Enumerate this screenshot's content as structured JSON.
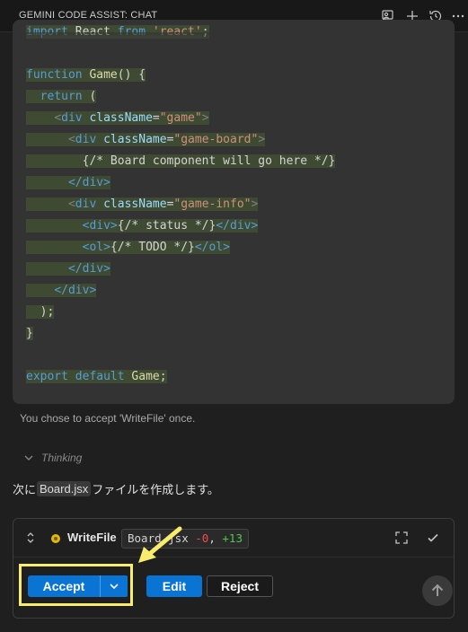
{
  "header": {
    "title": "GEMINI CODE ASSIST: CHAT",
    "icons": [
      "feedback-icon",
      "plus-icon",
      "history-icon",
      "more-icon"
    ]
  },
  "code": {
    "line_1": "import React from 'react';",
    "line_1_parts": {
      "import": "import",
      "react_id": " React ",
      "from": "from",
      "space": " ",
      "mod": "'react'",
      "semi": ";"
    },
    "line_3_parts": {
      "kw": "function",
      "name": " Game",
      "rest": "() {"
    },
    "line_4_parts": {
      "kw": "return",
      "rest": " ("
    },
    "line_5_parts": {
      "open": "<",
      "tag": "div",
      "attr": " className",
      "eq": "=",
      "val": "\"game\"",
      "close": ">"
    },
    "line_6_parts": {
      "open": "<",
      "tag": "div",
      "attr": " className",
      "eq": "=",
      "val": "\"game-board\"",
      "close": ">"
    },
    "line_7_parts": {
      "text": "{/* Board component will go here */}"
    },
    "line_8_parts": {
      "tag": "</div>"
    },
    "line_9_parts": {
      "open": "<",
      "tag": "div",
      "attr": " className",
      "eq": "=",
      "val": "\"game-info\"",
      "close": ">"
    },
    "line_10_parts": {
      "open": "<div>",
      "text": "{/* status */}",
      "close": "</div>"
    },
    "line_11_parts": {
      "open": "<ol>",
      "text": "{/* TODO */}",
      "close": "</ol>"
    },
    "line_12_parts": {
      "tag": "</div>"
    },
    "line_13_parts": {
      "tag": "</div>"
    },
    "line_14_parts": {
      "text": ");"
    },
    "line_15_parts": {
      "text": "}"
    },
    "line_17_parts": {
      "kw1": "export",
      "kw2": " default",
      "name": " Game",
      "semi": ";"
    }
  },
  "status_message": "You chose to accept 'WriteFile' once.",
  "thinking": {
    "label": "Thinking"
  },
  "next_line": {
    "before": "次に",
    "file": "Board.jsx",
    "after": "ファイルを作成します。"
  },
  "tool_card": {
    "tool_name": "WriteFile",
    "file": "Board.jsx",
    "minus": "-0",
    "comma": ",",
    "plus": "+13",
    "buttons": {
      "accept": "Accept",
      "edit": "Edit",
      "reject": "Reject"
    }
  },
  "colors": {
    "accent": "#0a74d4",
    "highlight": "#f7ec6e",
    "pending": "#e2b714"
  }
}
